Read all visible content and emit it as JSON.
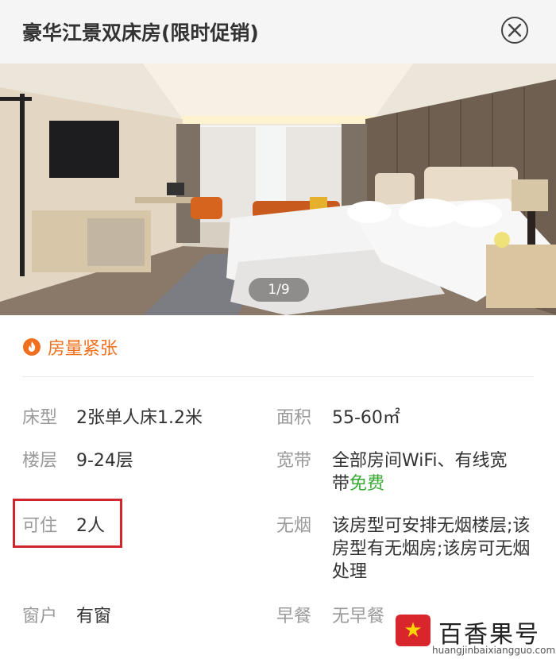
{
  "header": {
    "title": "豪华江景双床房(限时促销)"
  },
  "gallery": {
    "counter": "1/9"
  },
  "status": {
    "label": "房量紧张",
    "color": "#f07020"
  },
  "details": {
    "bed_type": {
      "key": "床型",
      "value": "2张单人床1.2米"
    },
    "area": {
      "key": "面积",
      "value": "55-60㎡"
    },
    "floor": {
      "key": "楼层",
      "value": "9-24层"
    },
    "broadband": {
      "key": "宽带",
      "value_prefix": "全部房间WiFi、有线宽带",
      "value_free": "免费"
    },
    "occupancy": {
      "key": "可住",
      "value": "2人"
    },
    "smoking": {
      "key": "无烟",
      "value": "该房型可安排无烟楼层;该房型有无烟房;该房可无烟处理"
    },
    "window": {
      "key": "窗户",
      "value": "有窗"
    },
    "breakfast": {
      "key": "早餐",
      "value": "无早餐"
    }
  },
  "watermark": {
    "name": "百香果号",
    "url": "huangjinbaixiangguo.com"
  },
  "colors": {
    "accent": "#f07020",
    "free": "#3aaa35",
    "highlight_box": "#d0272e"
  }
}
